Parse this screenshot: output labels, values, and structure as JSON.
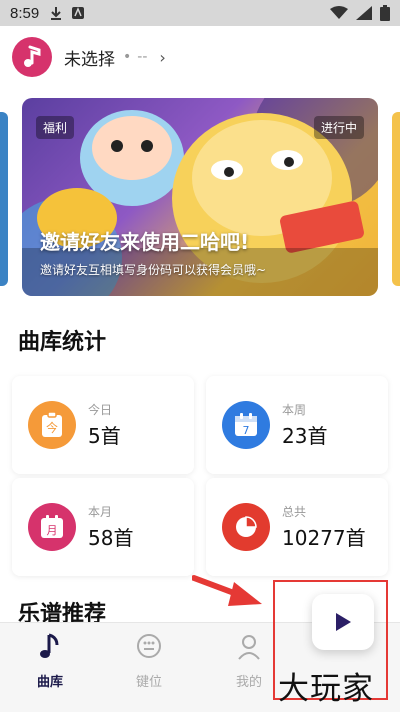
{
  "status_bar": {
    "time": "8:59"
  },
  "header": {
    "title": "未选择",
    "dot": "•",
    "subtitle": "--",
    "chevron": "›"
  },
  "banner": {
    "tag_left": "福利",
    "tag_right": "进行中",
    "title": "邀请好友来使用二哈吧!",
    "subtitle": "邀请好友互相填写身份码可以获得会员哦~"
  },
  "stats": {
    "title": "曲库统计",
    "items": [
      {
        "label": "今日",
        "value": "5首",
        "icon": "today-icon",
        "icon_text": "今",
        "color": "#f59a39"
      },
      {
        "label": "本周",
        "value": "23首",
        "icon": "calendar-week-icon",
        "icon_text": "7",
        "color": "#2f7be0"
      },
      {
        "label": "本月",
        "value": "58首",
        "icon": "calendar-month-icon",
        "icon_text": "月",
        "color": "#d6336c"
      },
      {
        "label": "总共",
        "value": "10277首",
        "icon": "pie-chart-icon",
        "icon_text": "",
        "color": "#e23b2e"
      }
    ]
  },
  "recommend": {
    "title": "乐谱推荐"
  },
  "tabs": [
    {
      "label": "曲库",
      "icon": "music-note-icon",
      "active": true
    },
    {
      "label": "键位",
      "icon": "keypad-icon",
      "active": false
    },
    {
      "label": "我的",
      "icon": "user-icon",
      "active": false
    }
  ],
  "watermark": "大玩家",
  "colors": {
    "accent_pink": "#d6336c",
    "highlight_red": "#e53935",
    "play_purple": "#2b1f66"
  }
}
